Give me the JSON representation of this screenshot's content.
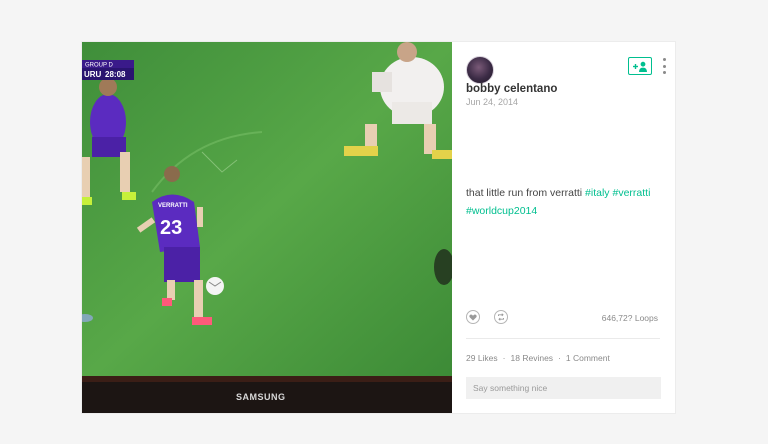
{
  "post": {
    "username": "bobby celentano",
    "date": "Jun 24, 2014",
    "caption_text": "that little run from verratti ",
    "hashtags": [
      "#italy",
      "#verratti",
      "#worldcup2014"
    ],
    "loops": "646,72? Loops",
    "likes": "29 Likes",
    "revines": "18 Revines",
    "comments": "1 Comment",
    "comment_placeholder": "Say something nice"
  },
  "video": {
    "scoreboard_group": "GROUP D",
    "scoreboard_team": "URU",
    "scoreboard_time": "28:08",
    "player_name": "VERRATTI",
    "player_number": "23",
    "tv_brand": "SAMSUNG"
  },
  "icons": {
    "follow": "add-user-icon",
    "more": "vertical-dots-icon",
    "like": "heart-icon",
    "revine": "revine-icon"
  },
  "colors": {
    "accent": "#00bf8f",
    "pitch": "#4a9a3e",
    "jersey": "#5b2bc0"
  }
}
